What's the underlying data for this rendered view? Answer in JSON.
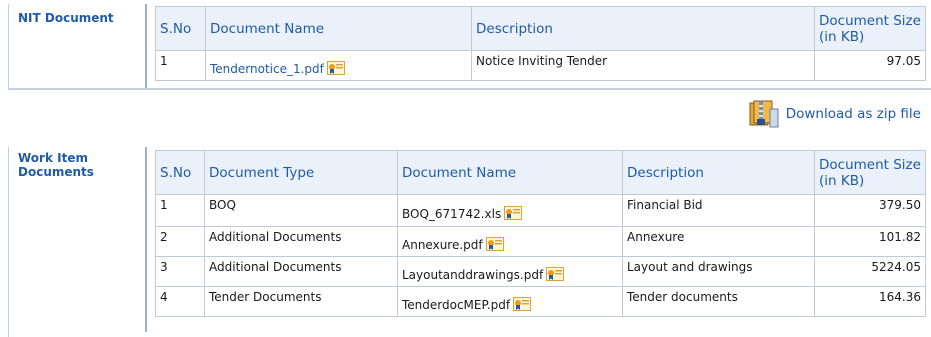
{
  "nit": {
    "label": "NIT Document",
    "headers": {
      "sno": "S.No",
      "name": "Document Name",
      "desc": "Description",
      "size": "Document Size (in KB)"
    },
    "rows": [
      {
        "sno": "1",
        "name": "Tendernotice_1.pdf",
        "desc": "Notice Inviting Tender",
        "size": "97.05"
      }
    ]
  },
  "download": {
    "label": "Download as zip file"
  },
  "work": {
    "label_line1": "Work Item",
    "label_line2": "Documents",
    "headers": {
      "sno": "S.No",
      "type": "Document Type",
      "name": "Document Name",
      "desc": "Description",
      "size": "Document Size (in KB)"
    },
    "rows": [
      {
        "sno": "1",
        "type": "BOQ",
        "name": "BOQ_671742.xls",
        "desc": "Financial Bid",
        "size": "379.50"
      },
      {
        "sno": "2",
        "type": "Additional Documents",
        "name": "Annexure.pdf",
        "desc": "Annexure",
        "size": "101.82"
      },
      {
        "sno": "3",
        "type": "Additional Documents",
        "name": "Layoutanddrawings.pdf",
        "desc": "Layout and drawings",
        "size": "5224.05"
      },
      {
        "sno": "4",
        "type": "Tender Documents",
        "name": "TenderdocMEP.pdf",
        "desc": "Tender documents",
        "size": "164.36"
      }
    ]
  },
  "icons": {
    "file": "certificate-file-icon",
    "zip": "zip-archive-icon"
  }
}
